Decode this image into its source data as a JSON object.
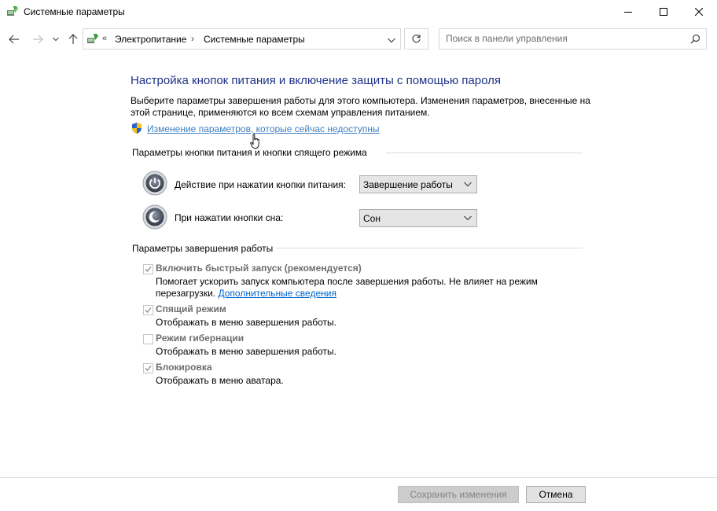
{
  "window": {
    "title": "Системные параметры"
  },
  "nav": {
    "breadcrumb": [
      "Электропитание",
      "Системные параметры"
    ],
    "overflow_chevron": "«",
    "separator": "›",
    "search_placeholder": "Поиск в панели управления"
  },
  "content": {
    "title": "Настройка кнопок питания и включение защиты с помощью пароля",
    "description": "Выберите параметры завершения работы для этого компьютера. Изменения параметров, внесенные на этой странице, применяются ко всем схемам управления питанием.",
    "change_link": "Изменение параметров, которые сейчас недоступны",
    "section_buttons": "Параметры кнопки питания и кнопки спящего режима",
    "power_button": {
      "label": "Действие при нажатии кнопки питания:",
      "value": "Завершение работы"
    },
    "sleep_button": {
      "label": "При нажатии кнопки сна:",
      "value": "Сон"
    },
    "section_shutdown": "Параметры завершения работы",
    "options": [
      {
        "title": "Включить быстрый запуск (рекомендуется)",
        "checked": true,
        "desc": "Помогает ускорить запуск компьютера после завершения работы. Не влияет на режим перезагрузки.",
        "link": "Дополнительные сведения"
      },
      {
        "title": "Спящий режим",
        "checked": true,
        "desc": "Отображать в меню завершения работы."
      },
      {
        "title": "Режим гибернации",
        "checked": false,
        "desc": "Отображать в меню завершения работы."
      },
      {
        "title": "Блокировка",
        "checked": true,
        "desc": "Отображать в меню аватара."
      }
    ]
  },
  "footer": {
    "save_label": "Сохранить изменения",
    "cancel_label": "Отмена"
  },
  "colors": {
    "title_blue": "#1e3287",
    "link_blue": "#3f7fc2",
    "disabled_gray": "#6d6d6d"
  }
}
